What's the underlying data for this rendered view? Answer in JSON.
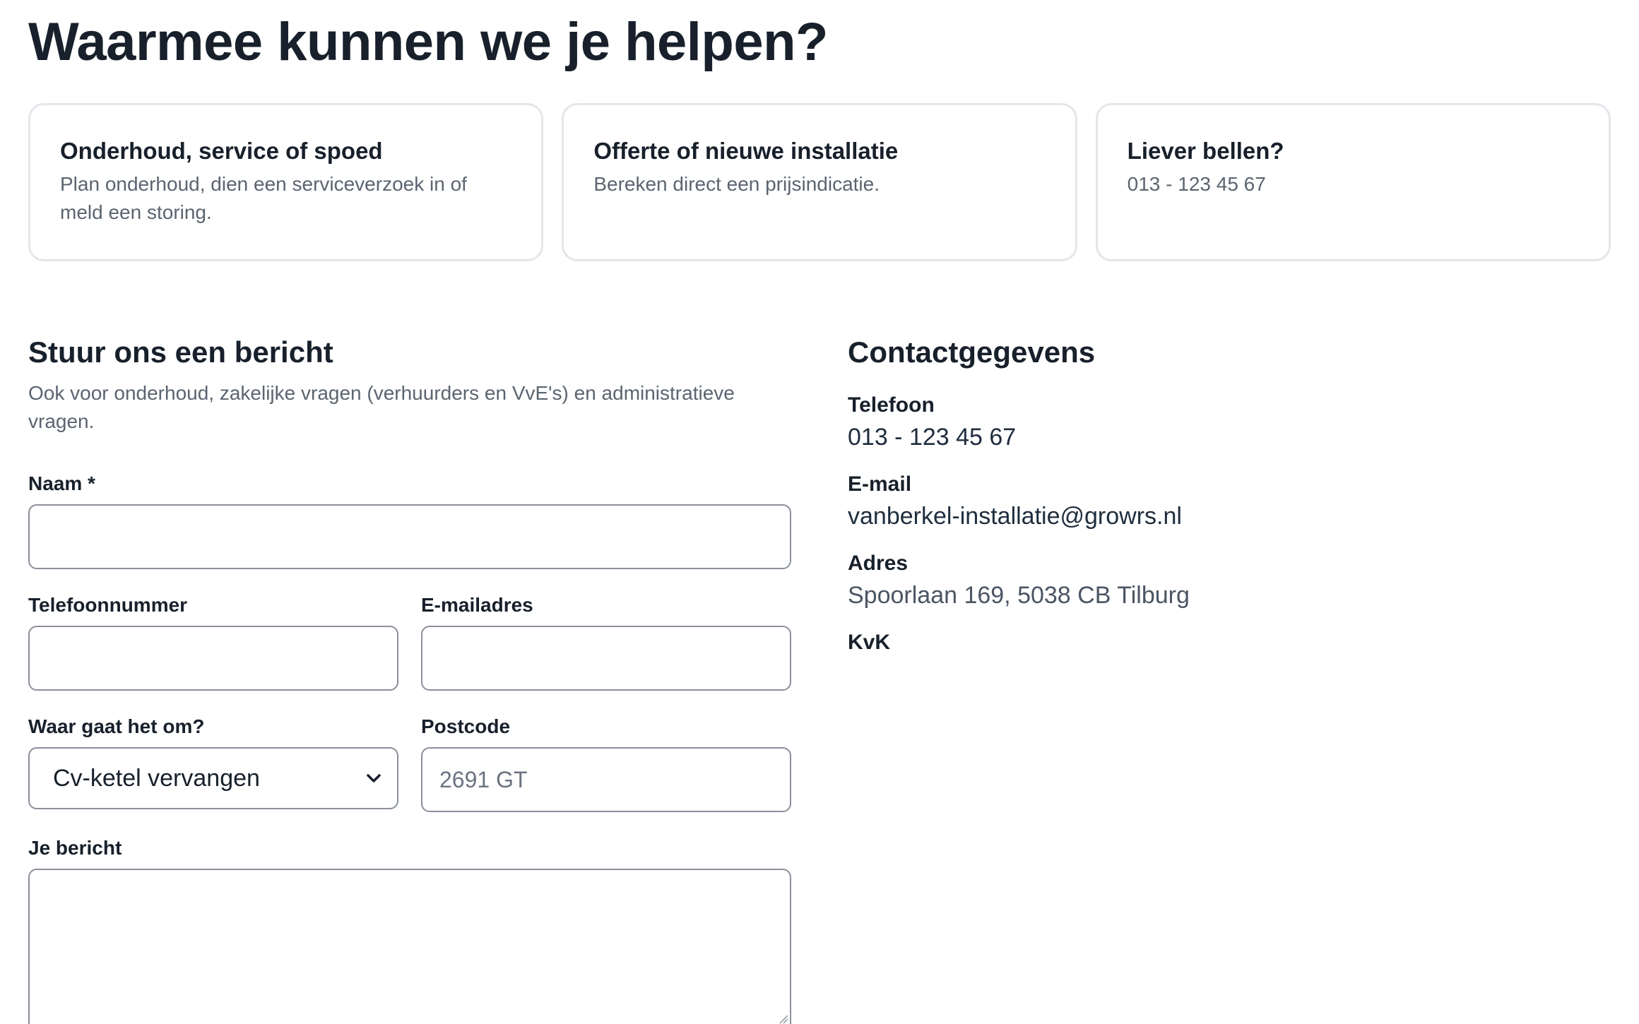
{
  "page": {
    "title": "Waarmee kunnen we je helpen?"
  },
  "cards": [
    {
      "title": "Onderhoud, service of spoed",
      "text": "Plan onderhoud, dien een serviceverzoek in of meld een storing."
    },
    {
      "title": "Offerte of nieuwe installatie",
      "text": "Bereken direct een prijsindicatie."
    },
    {
      "title": "Liever bellen?",
      "text": "013 - 123 45 67"
    }
  ],
  "form": {
    "title": "Stuur ons een bericht",
    "intro": "Ook voor onderhoud, zakelijke vragen (verhuurders en VvE's) en administratieve vragen.",
    "name_label": "Naam *",
    "name_value": "",
    "phone_label": "Telefoonnummer",
    "phone_value": "",
    "email_label": "E-mailadres",
    "email_value": "",
    "subject_label": "Waar gaat het om?",
    "subject_selected": "Cv-ketel vervangen",
    "postcode_label": "Postcode",
    "postcode_value": "",
    "postcode_placeholder": "2691 GT",
    "message_label": "Je bericht",
    "message_value": ""
  },
  "contact": {
    "title": "Contactgegevens",
    "phone_label": "Telefoon",
    "phone_value": "013 - 123 45 67",
    "email_label": "E-mail",
    "email_value": "vanberkel-installatie@growrs.nl",
    "address_label": "Adres",
    "address_value": "Spoorlaan 169, 5038 CB Tilburg",
    "kvk_label": "KvK"
  }
}
